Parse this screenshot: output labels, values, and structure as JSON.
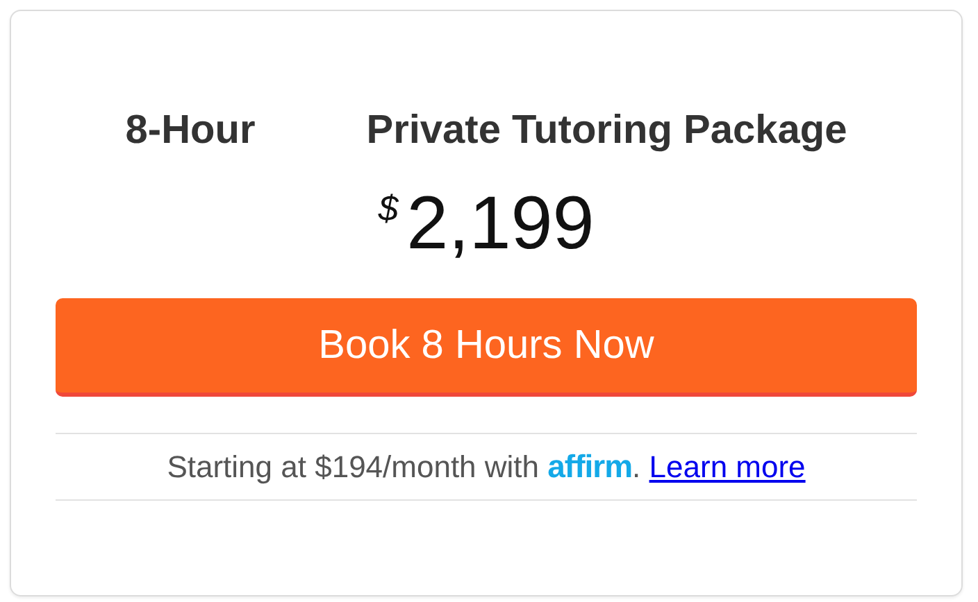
{
  "package": {
    "title_start": "8-Hour",
    "title_end": "Private Tutoring Package",
    "currency": "$",
    "price": "2,199"
  },
  "book_button": {
    "label": "Book 8 Hours Now"
  },
  "financing": {
    "text": "Starting at $194/month with ",
    "lender": "affirm",
    "after": ".",
    "link": "Learn more"
  }
}
